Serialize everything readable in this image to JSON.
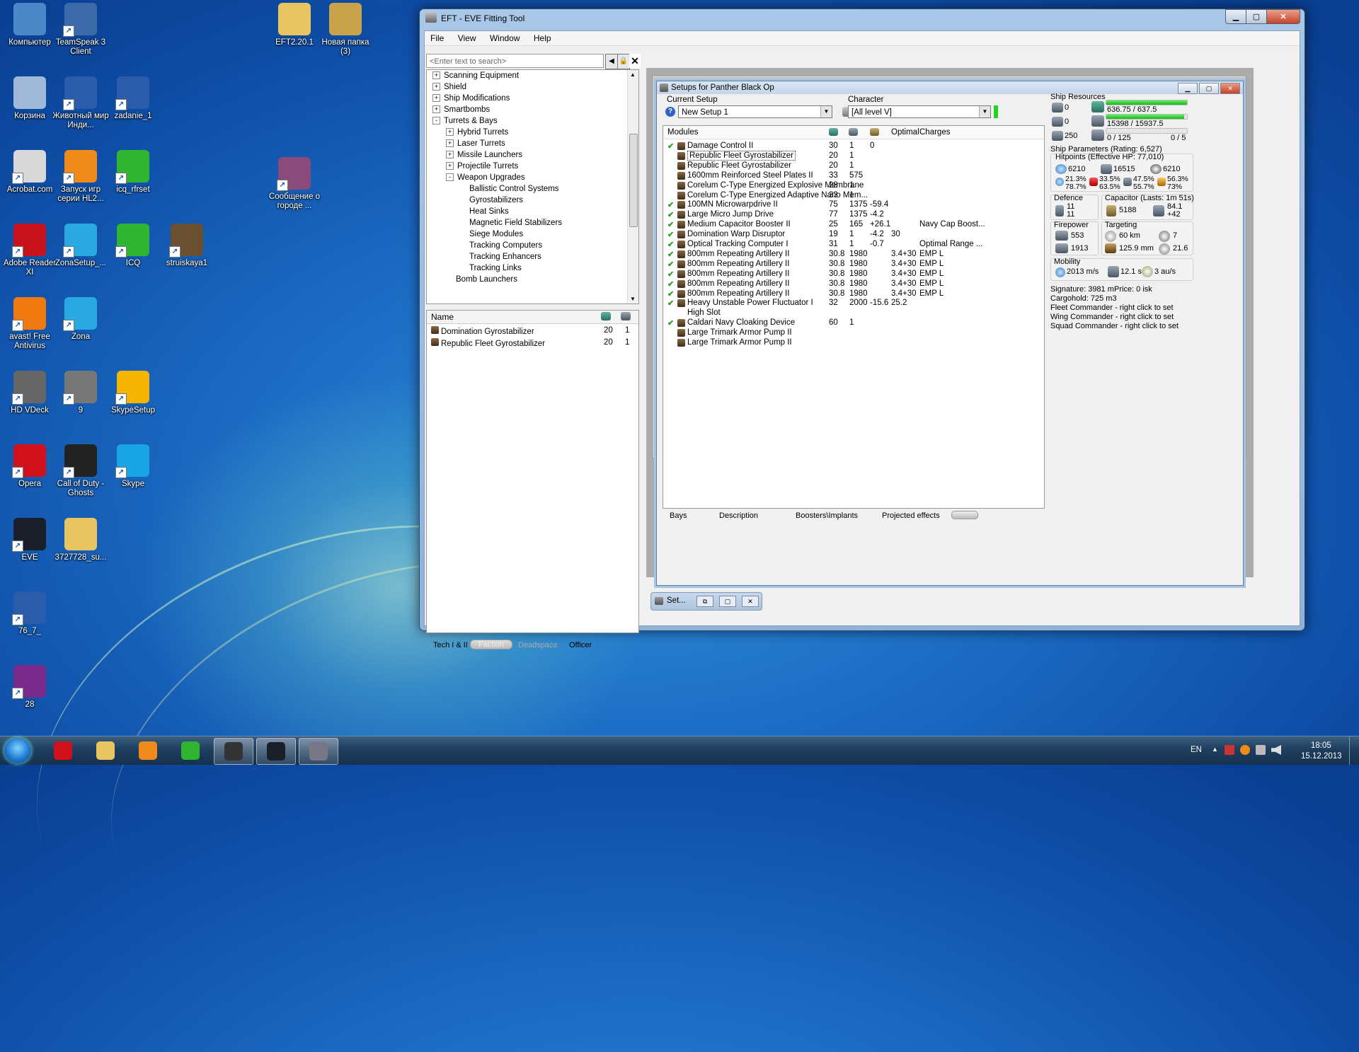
{
  "desktop": {
    "icons": [
      {
        "label": "Компьютер",
        "icon": "computer-icon",
        "color": "#4a88c8"
      },
      {
        "label": "TeamSpeak 3 Client",
        "icon": "teamspeak-icon",
        "color": "#3d6aa8"
      },
      {
        "label": "EFT2.20.1",
        "icon": "folder-icon",
        "color": "#e8c560"
      },
      {
        "label": "Новая папка (3)",
        "icon": "folder-icon",
        "color": "#c9a34a"
      },
      {
        "label": "Корзина",
        "icon": "recycle-bin-icon",
        "color": "#9fb9d6"
      },
      {
        "label": "Животный мир Инди...",
        "icon": "word-doc-icon",
        "color": "#2b5caa"
      },
      {
        "label": "zadanie_1",
        "icon": "word-doc-icon",
        "color": "#2b5caa"
      },
      {
        "label": "Acrobat.com",
        "icon": "acrobat-icon",
        "color": "#d8d8d8"
      },
      {
        "label": "Запуск игр серии HL2...",
        "icon": "half-life-icon",
        "color": "#f08a1a"
      },
      {
        "label": "icq_rfrset",
        "icon": "icq-flower-icon",
        "color": "#2fb52f"
      },
      {
        "label": "Сообщение о городе ...",
        "icon": "message-icon",
        "color": "#8a4a7a"
      },
      {
        "label": "Adobe Reader XI",
        "icon": "adobe-reader-icon",
        "color": "#c8121b"
      },
      {
        "label": "ZonaSetup_...",
        "icon": "zona-icon",
        "color": "#2aa9e0"
      },
      {
        "label": "ICQ",
        "icon": "icq-flower-icon",
        "color": "#2fb52f"
      },
      {
        "label": "struiskaya1",
        "icon": "portrait-image-icon",
        "color": "#6a5030"
      },
      {
        "label": "avast! Free Antivirus",
        "icon": "avast-icon",
        "color": "#f07a10"
      },
      {
        "label": "Zona",
        "icon": "zona-icon",
        "color": "#2aa9e0"
      },
      {
        "label": "HD VDeck",
        "icon": "speaker-icon",
        "color": "#666"
      },
      {
        "label": "9",
        "icon": "image-file-icon",
        "color": "#777"
      },
      {
        "label": "SkypeSetup",
        "icon": "skype-setup-icon",
        "color": "#f4b400"
      },
      {
        "label": "Opera",
        "icon": "opera-icon",
        "color": "#d0101a"
      },
      {
        "label": "Call of Duty - Ghosts",
        "icon": "call-of-duty-icon",
        "color": "#222"
      },
      {
        "label": "Skype",
        "icon": "skype-icon",
        "color": "#19a4e6"
      },
      {
        "label": "EVE",
        "icon": "eve-icon",
        "color": "#1a1f2a"
      },
      {
        "label": "3727728_su...",
        "icon": "folder-icon",
        "color": "#e8c560"
      },
      {
        "label": "76_7_",
        "icon": "word-doc-icon",
        "color": "#2b5caa"
      },
      {
        "label": "28",
        "icon": "winrar-icon",
        "color": "#7a2a8a"
      }
    ]
  },
  "taskbar": {
    "apps": [
      "opera-icon",
      "explorer-folder-icon",
      "media-player-icon",
      "icq-flower-icon",
      "task-list-icon",
      "eve-icon",
      "eft-icon"
    ],
    "lang": "EN",
    "time": "18:05",
    "date": "15.12.2013"
  },
  "window": {
    "title": "EFT - EVE Fitting Tool",
    "menu": [
      "File",
      "View",
      "Window",
      "Help"
    ],
    "search_placeholder": "<Enter text to search>",
    "tree": [
      {
        "label": "Scanning Equipment",
        "depth": 0,
        "sign": "+"
      },
      {
        "label": "Shield",
        "depth": 0,
        "sign": "+"
      },
      {
        "label": "Ship Modifications",
        "depth": 0,
        "sign": "+"
      },
      {
        "label": "Smartbombs",
        "depth": 0,
        "sign": "+"
      },
      {
        "label": "Turrets & Bays",
        "depth": 0,
        "sign": "-"
      },
      {
        "label": "Hybrid Turrets",
        "depth": 1,
        "sign": "+"
      },
      {
        "label": "Laser Turrets",
        "depth": 1,
        "sign": "+"
      },
      {
        "label": "Missile Launchers",
        "depth": 1,
        "sign": "+"
      },
      {
        "label": "Projectile Turrets",
        "depth": 1,
        "sign": "+"
      },
      {
        "label": "Weapon Upgrades",
        "depth": 1,
        "sign": "-"
      },
      {
        "label": "Ballistic Control Systems",
        "depth": 2,
        "sign": ""
      },
      {
        "label": "Gyrostabilizers",
        "depth": 2,
        "sign": ""
      },
      {
        "label": "Heat Sinks",
        "depth": 2,
        "sign": ""
      },
      {
        "label": "Magnetic Field Stabilizers",
        "depth": 2,
        "sign": ""
      },
      {
        "label": "Siege Modules",
        "depth": 2,
        "sign": ""
      },
      {
        "label": "Tracking Computers",
        "depth": 2,
        "sign": ""
      },
      {
        "label": "Tracking Enhancers",
        "depth": 2,
        "sign": ""
      },
      {
        "label": "Tracking Links",
        "depth": 2,
        "sign": ""
      },
      {
        "label": "Bomb Launchers",
        "depth": 1,
        "sign": ""
      }
    ],
    "list_header": "Name",
    "list_rows": [
      {
        "name": "Domination Gyrostabilizer",
        "a": "20",
        "b": "1"
      },
      {
        "name": "Republic Fleet Gyrostabilizer",
        "a": "20",
        "b": "1"
      }
    ],
    "bottom_tabs": [
      "Tech I & II",
      "Faction",
      "Deadspace",
      "Officer"
    ]
  },
  "setup": {
    "title": "Setups for Panther Black Op",
    "current_setup_label": "Current Setup",
    "current_setup_value": "New Setup 1",
    "character_label": "Character",
    "character_value": "[All level V]",
    "modules_header": "Modules",
    "optimal_header": "Optimal",
    "charges_header": "Charges",
    "modules": [
      {
        "chk": true,
        "name": "Damage Control II",
        "cpu": "30",
        "pg": "1",
        "cap": "0",
        "opt": "",
        "chg": ""
      },
      {
        "chk": false,
        "name": "Republic Fleet Gyrostabilizer",
        "cpu": "20",
        "pg": "1",
        "cap": "",
        "opt": "",
        "chg": ""
      },
      {
        "chk": false,
        "name": "Republic Fleet Gyrostabilizer",
        "cpu": "20",
        "pg": "1",
        "cap": "",
        "opt": "",
        "chg": ""
      },
      {
        "chk": false,
        "name": "1600mm Reinforced Steel Plates II",
        "cpu": "33",
        "pg": "575",
        "cap": "",
        "opt": "",
        "chg": ""
      },
      {
        "chk": false,
        "name": "Corelum C-Type Energized Explosive Membrane",
        "cpu": "28",
        "pg": "1",
        "cap": "",
        "opt": "",
        "chg": ""
      },
      {
        "chk": false,
        "name": "Corelum C-Type Energized Adaptive Nano Mem...",
        "cpu": "33",
        "pg": "1",
        "cap": "",
        "opt": "",
        "chg": ""
      },
      {
        "chk": true,
        "name": "100MN Microwarpdrive II",
        "cpu": "75",
        "pg": "1375",
        "cap": "-59.4",
        "opt": "",
        "chg": ""
      },
      {
        "chk": true,
        "name": "Large Micro Jump Drive",
        "cpu": "77",
        "pg": "1375",
        "cap": "-4.2",
        "opt": "",
        "chg": ""
      },
      {
        "chk": true,
        "name": "Medium Capacitor Booster II",
        "cpu": "25",
        "pg": "165",
        "cap": "+26.1",
        "opt": "",
        "chg": "Navy Cap Boost..."
      },
      {
        "chk": true,
        "name": "Domination Warp Disruptor",
        "cpu": "19",
        "pg": "1",
        "cap": "-4.2",
        "opt": "30",
        "chg": ""
      },
      {
        "chk": true,
        "name": "Optical Tracking Computer I",
        "cpu": "31",
        "pg": "1",
        "cap": "-0.7",
        "opt": "",
        "chg": "Optimal Range ..."
      },
      {
        "chk": true,
        "name": "800mm Repeating Artillery II",
        "cpu": "30.8",
        "pg": "1980",
        "cap": "",
        "opt": "3.4+30",
        "chg": "EMP L"
      },
      {
        "chk": true,
        "name": "800mm Repeating Artillery II",
        "cpu": "30.8",
        "pg": "1980",
        "cap": "",
        "opt": "3.4+30",
        "chg": "EMP L"
      },
      {
        "chk": true,
        "name": "800mm Repeating Artillery II",
        "cpu": "30.8",
        "pg": "1980",
        "cap": "",
        "opt": "3.4+30",
        "chg": "EMP L"
      },
      {
        "chk": true,
        "name": "800mm Repeating Artillery II",
        "cpu": "30.8",
        "pg": "1980",
        "cap": "",
        "opt": "3.4+30",
        "chg": "EMP L"
      },
      {
        "chk": true,
        "name": "800mm Repeating Artillery II",
        "cpu": "30.8",
        "pg": "1980",
        "cap": "",
        "opt": "3.4+30",
        "chg": "EMP L"
      },
      {
        "chk": true,
        "name": "Heavy Unstable Power Fluctuator I",
        "cpu": "32",
        "pg": "2000",
        "cap": "-15.6",
        "opt": "25.2",
        "chg": ""
      },
      {
        "chk": false,
        "name": "High Slot",
        "cpu": "",
        "pg": "",
        "cap": "",
        "opt": "",
        "chg": ""
      },
      {
        "chk": true,
        "name": "Caldari Navy Cloaking Device",
        "cpu": "60",
        "pg": "1",
        "cap": "",
        "opt": "",
        "chg": ""
      },
      {
        "chk": false,
        "name": "Large Trimark Armor Pump II",
        "cpu": "",
        "pg": "",
        "cap": "",
        "opt": "",
        "chg": ""
      },
      {
        "chk": false,
        "name": "Large Trimark Armor Pump II",
        "cpu": "",
        "pg": "",
        "cap": "",
        "opt": "",
        "chg": ""
      }
    ],
    "sub_tabs": [
      "Bays",
      "Description",
      "Boosters\\Implants",
      "Projected effects"
    ],
    "resources": {
      "title": "Ship Resources",
      "left": [
        "0",
        "0",
        "250"
      ],
      "cpu_text": "636.75 / 637.5",
      "pg_text": "15398 / 15937.5",
      "cal_text": "0 / 125",
      "slots_text": "0 / 5",
      "cpu_fraction": 0.999,
      "pg_fraction": 0.966
    },
    "params": {
      "title": "Ship Parameters (Rating: 6,527)",
      "hp_title": "Hitpoints (Effective HP: 77,010)",
      "hp": [
        "6210",
        "16515",
        "6210"
      ],
      "res": [
        [
          "21.3%",
          "78.7%"
        ],
        [
          "33.5%",
          "63.5%"
        ],
        [
          "47.5%",
          "55.7%"
        ],
        [
          "56.3%",
          "73%"
        ]
      ],
      "defence_title": "Defence",
      "defence": [
        "11",
        "11"
      ],
      "cap_title": "Capacitor (Lasts: 1m 51s)",
      "cap": [
        "5188",
        "84.1",
        "+42"
      ],
      "fire_title": "Firepower",
      "fire": [
        "553",
        "1913"
      ],
      "target_title": "Targeting",
      "target": [
        "60 km",
        "7",
        "125.9 mm",
        "21.6"
      ],
      "mob_title": "Mobility",
      "mob": [
        "2013 m/s",
        "12.1 s",
        "3 au/s"
      ],
      "signature": "Signature: 3981 m",
      "price": "Price: 0 isk",
      "cargo": "Cargohold: 725 m3",
      "fleet": "Fleet Commander - right click to set",
      "wing": "Wing Commander - right click to set",
      "squad": "Squad Commander - right click to set"
    },
    "minimized": "Set..."
  }
}
